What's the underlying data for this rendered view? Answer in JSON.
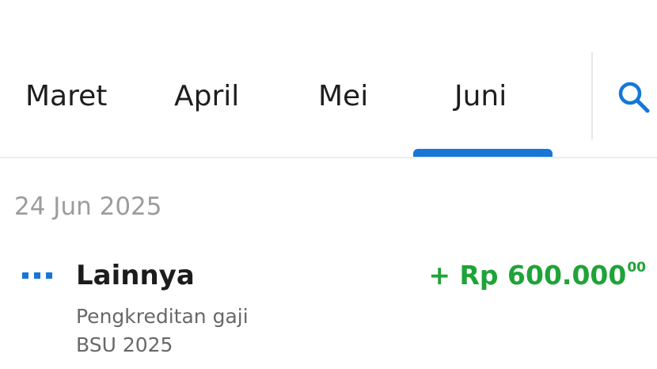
{
  "month_tabs": [
    {
      "label": "Maret",
      "active": false
    },
    {
      "label": "April",
      "active": false
    },
    {
      "label": "Mei",
      "active": false
    },
    {
      "label": "Juni",
      "active": true
    }
  ],
  "search": {
    "icon": "search-icon"
  },
  "accent_color": "#1677d8",
  "transactions": [
    {
      "date": "24 Jun 2025",
      "category": "Lainnya",
      "description_line_1": "Pengkreditan gaji",
      "description_line_2": "BSU 2025",
      "amount": "+ Rp 600.000",
      "amount_cents": "00",
      "amount_color": "#1fa339",
      "icon": "more-dots-icon"
    }
  ]
}
